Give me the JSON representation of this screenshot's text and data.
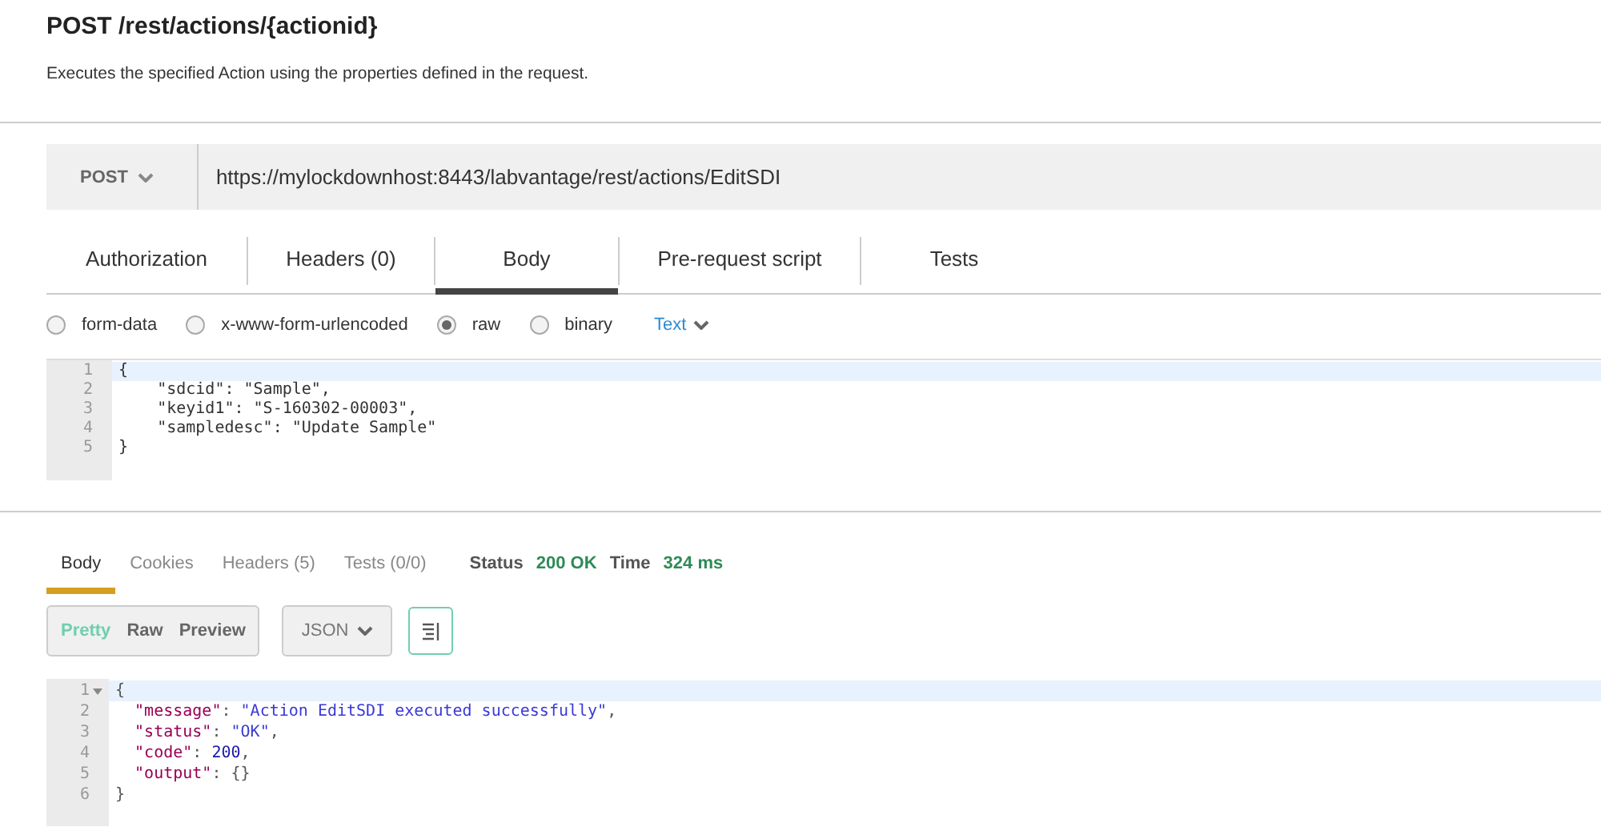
{
  "title": "POST /rest/actions/{actionid}",
  "description": "Executes the specified Action using the properties defined in the request.",
  "request": {
    "method": "POST",
    "url": "https://mylockdownhost:8443/labvantage/rest/actions/EditSDI"
  },
  "tabs": [
    {
      "label": "Authorization",
      "selected": false
    },
    {
      "label": "Headers (0)",
      "selected": false
    },
    {
      "label": "Body",
      "selected": true
    },
    {
      "label": "Pre-request script",
      "selected": false
    },
    {
      "label": "Tests",
      "selected": false
    }
  ],
  "body_types": [
    {
      "label": "form-data",
      "selected": false
    },
    {
      "label": "x-www-form-urlencoded",
      "selected": false
    },
    {
      "label": "raw",
      "selected": true
    },
    {
      "label": "binary",
      "selected": false
    }
  ],
  "format": "Text",
  "request_body": [
    {
      "number": "1",
      "text": "{"
    },
    {
      "number": "2",
      "text": "    \"sdcid\": \"Sample\","
    },
    {
      "number": "3",
      "text": "    \"keyid1\": \"S-160302-00003\","
    },
    {
      "number": "4",
      "text": "    \"sampledesc\": \"Update Sample\""
    },
    {
      "number": "5",
      "text": "}"
    }
  ],
  "response_tabs": [
    {
      "label": "Body",
      "selected": true
    },
    {
      "label": "Cookies",
      "selected": false
    },
    {
      "label": "Headers (5)",
      "selected": false
    },
    {
      "label": "Tests (0/0)",
      "selected": false
    }
  ],
  "status": {
    "status_label": "Status",
    "status_value": "200 OK",
    "time_label": "Time",
    "time_value": "324 ms"
  },
  "view_modes": [
    {
      "label": "Pretty",
      "selected": true
    },
    {
      "label": "Raw",
      "selected": false
    },
    {
      "label": "Preview",
      "selected": false
    }
  ],
  "response_format": "JSON",
  "response_body": [
    {
      "number": "1",
      "foldable": true,
      "tokens": [
        {
          "kind": "punct",
          "text": "{"
        }
      ]
    },
    {
      "number": "2",
      "foldable": false,
      "tokens": [
        {
          "kind": "key",
          "text": "  \"message\""
        },
        {
          "kind": "punct",
          "text": ": "
        },
        {
          "kind": "string",
          "text": "\"Action EditSDI executed successfully\""
        },
        {
          "kind": "punct",
          "text": ","
        }
      ]
    },
    {
      "number": "3",
      "foldable": false,
      "tokens": [
        {
          "kind": "key",
          "text": "  \"status\""
        },
        {
          "kind": "punct",
          "text": ": "
        },
        {
          "kind": "string",
          "text": "\"OK\""
        },
        {
          "kind": "punct",
          "text": ","
        }
      ]
    },
    {
      "number": "4",
      "foldable": false,
      "tokens": [
        {
          "kind": "key",
          "text": "  \"code\""
        },
        {
          "kind": "punct",
          "text": ": "
        },
        {
          "kind": "number",
          "text": "200"
        },
        {
          "kind": "punct",
          "text": ","
        }
      ]
    },
    {
      "number": "5",
      "foldable": false,
      "tokens": [
        {
          "kind": "key",
          "text": "  \"output\""
        },
        {
          "kind": "punct",
          "text": ": {}"
        }
      ]
    },
    {
      "number": "6",
      "foldable": false,
      "tokens": [
        {
          "kind": "punct",
          "text": "}"
        }
      ]
    }
  ]
}
